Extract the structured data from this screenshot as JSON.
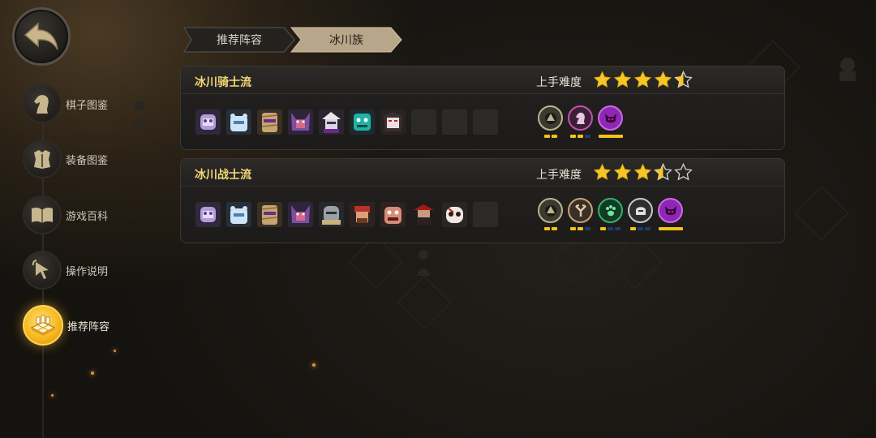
{
  "nav": {
    "back_icon": "back-arrow-icon",
    "items": [
      {
        "label": "棋子图鉴",
        "icon": "chess-knight-icon",
        "active": false
      },
      {
        "label": "装备图鉴",
        "icon": "armor-icon",
        "active": false
      },
      {
        "label": "游戏百科",
        "icon": "book-icon",
        "active": false
      },
      {
        "label": "操作说明",
        "icon": "pointer-icon",
        "active": false
      },
      {
        "label": "推荐阵容",
        "icon": "chessboard-icon",
        "active": true
      }
    ]
  },
  "breadcrumb": {
    "tabs": [
      {
        "label": "推荐阵容",
        "active": false
      },
      {
        "label": "冰川族",
        "active": true
      }
    ]
  },
  "lineups": [
    {
      "title": "冰川骑士流",
      "difficulty_label": "上手难度",
      "difficulty_stars": 4.5,
      "max_stars": 5,
      "heroes": [
        "purple-golem",
        "ice-bear",
        "mummy",
        "bat-demon",
        "white-witch",
        "teal-ghoul",
        "vampire"
      ],
      "empty_slots": 3,
      "synergies": [
        {
          "icon": "glacier-icon",
          "color": "#bdb48e",
          "active": 2,
          "total": 2
        },
        {
          "icon": "knight-icon",
          "color": "#c253b0",
          "active": 2,
          "total": 3
        },
        {
          "icon": "demon-icon",
          "color": "#b23ad6",
          "active": 1,
          "total": 1
        }
      ]
    },
    {
      "title": "冰川战士流",
      "difficulty_label": "上手难度",
      "difficulty_stars": 3.5,
      "max_stars": 5,
      "heroes": [
        "purple-golem",
        "ice-bear",
        "mummy",
        "bat-demon",
        "grey-knight",
        "red-warrior",
        "ogre",
        "pirate",
        "skull-mask"
      ],
      "empty_slots": 1,
      "synergies": [
        {
          "icon": "glacier-icon",
          "color": "#bdb48e",
          "active": 2,
          "total": 2
        },
        {
          "icon": "warrior-icon",
          "color": "#c8a27a",
          "active": 2,
          "total": 3
        },
        {
          "icon": "paw-icon",
          "color": "#2fb56a",
          "active": 1,
          "total": 3
        },
        {
          "icon": "helm-icon",
          "color": "#c9c9c9",
          "active": 1,
          "total": 3
        },
        {
          "icon": "demon-icon",
          "color": "#b23ad6",
          "active": 1,
          "total": 1
        }
      ]
    }
  ]
}
